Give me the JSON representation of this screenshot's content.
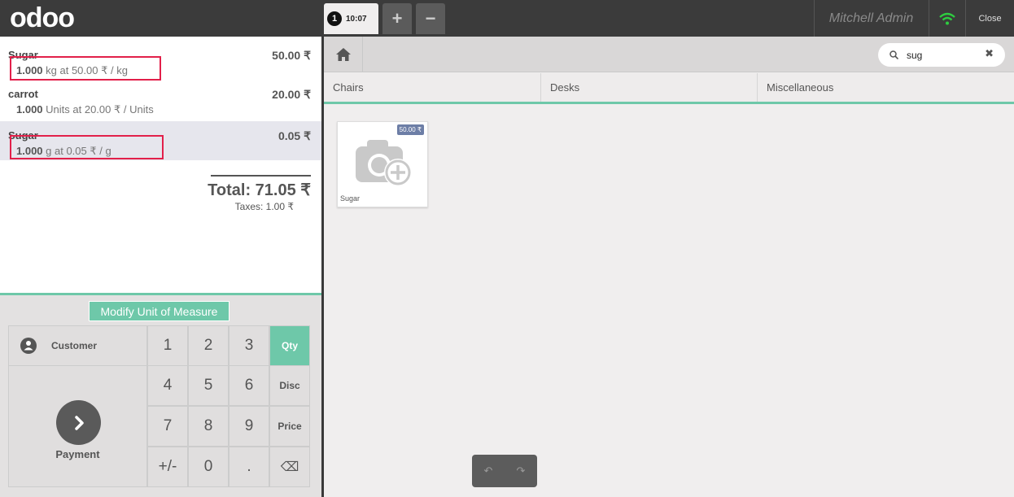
{
  "header": {
    "logo": "odoo",
    "order_number": "1",
    "order_time": "10:07",
    "add_order_label": "+",
    "remove_order_label": "−",
    "user_name": "Mitchell Admin",
    "close_label": "Close"
  },
  "orderlines": [
    {
      "name": "Sugar",
      "price": "50.00 ₹",
      "qty": "1.000",
      "detail": " kg at 50.00 ₹ / kg"
    },
    {
      "name": "carrot",
      "price": "20.00 ₹",
      "qty": "1.000",
      "detail": " Units at 20.00 ₹ / Units"
    },
    {
      "name": "Sugar",
      "price": "0.05 ₹",
      "qty": "1.000",
      "detail": " g at 0.05 ₹ / g"
    }
  ],
  "summary": {
    "total": "Total: 71.05 ₹",
    "taxes": "Taxes: 1.00 ₹"
  },
  "controls": {
    "modify_uom_label": "Modify Unit of Measure",
    "customer_label": "Customer",
    "payment_label": "Payment"
  },
  "numpad": {
    "keys": [
      "1",
      "2",
      "3",
      "4",
      "5",
      "6",
      "7",
      "8",
      "9",
      "+/-",
      "0",
      "."
    ],
    "modes": [
      "Qty",
      "Disc",
      "Price"
    ],
    "backspace": "⌫"
  },
  "search": {
    "value": "sug",
    "clear_label": "✖"
  },
  "categories": [
    "Chairs",
    "Desks",
    "Miscellaneous"
  ],
  "products": [
    {
      "name": "Sugar",
      "price": "50.00 ₹"
    }
  ],
  "colors": {
    "accent": "#6ec8a9",
    "highlight_box": "#e2204a",
    "price_tag": "#6d7ea6",
    "topbar": "#3b3b3b",
    "wifi": "#2ecc40"
  },
  "undo_label": "↶",
  "redo_label": "↷"
}
